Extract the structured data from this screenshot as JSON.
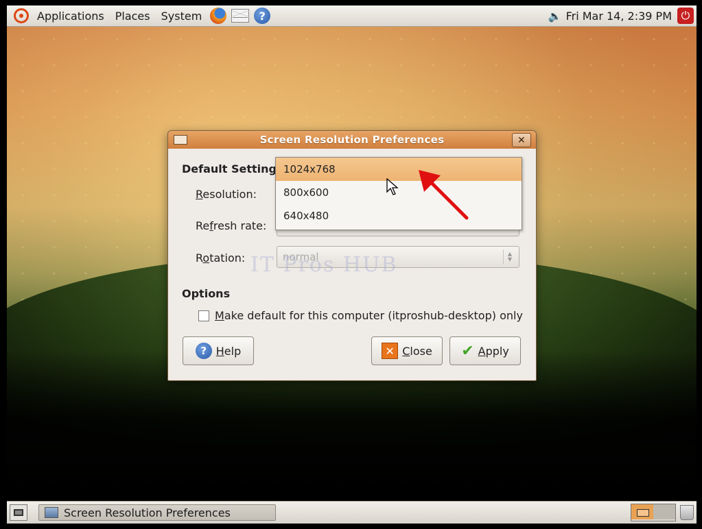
{
  "top_panel": {
    "menus": [
      "Applications",
      "Places",
      "System"
    ],
    "clock": "Fri Mar 14,  2:39 PM"
  },
  "dialog": {
    "title": "Screen Resolution Preferences",
    "section_default": "Default Setting",
    "resolution_label_mnemonic": "R",
    "resolution_label_rest": "esolution:",
    "refresh_label_pre": "Re",
    "refresh_label_mnemonic": "f",
    "refresh_label_rest": "resh rate:",
    "rotation_label_pre": "R",
    "rotation_label_mnemonic": "o",
    "rotation_label_rest": "tation:",
    "rotation_value": "normal",
    "section_options": "Options",
    "checkbox_mnemonic": "M",
    "checkbox_rest": "ake default for this computer (itproshub-desktop) only",
    "checkbox_checked": false,
    "help_mnemonic": "H",
    "help_rest": "elp",
    "close_mnemonic": "C",
    "close_rest": "lose",
    "apply_mnemonic": "A",
    "apply_rest": "pply",
    "watermark": "IT Pros HUB"
  },
  "dropdown": {
    "options": [
      "1024x768",
      "800x600",
      "640x480"
    ],
    "selected_index": 0
  },
  "taskbar": {
    "window_button": "Screen Resolution Preferences"
  },
  "colors": {
    "title_bar": "#d58a47",
    "selection": "#f0b878",
    "annotation_arrow": "#e01010"
  }
}
